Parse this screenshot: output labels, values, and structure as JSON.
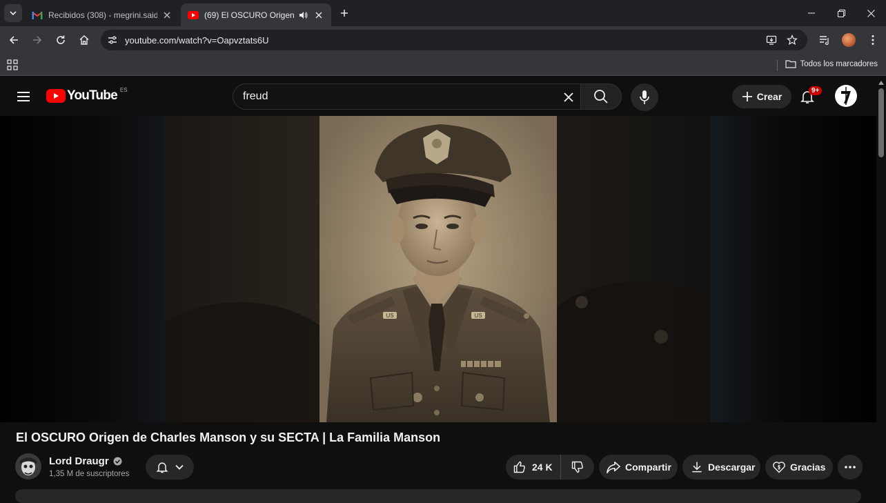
{
  "browser": {
    "tabs": [
      {
        "title": "Recibidos (308) - megrini.said@",
        "icon": "gmail-icon",
        "active": false
      },
      {
        "title": "(69) El OSCURO Origen de",
        "icon": "youtube-icon",
        "active": true,
        "audio": true
      }
    ],
    "url": "youtube.com/watch?v=Oapvztats6U",
    "bookmarks_all_label": "Todos los marcadores"
  },
  "youtube": {
    "logo_text": "YouTube",
    "country_code": "ES",
    "search_query": "freud",
    "create_label": "Crear",
    "notifications_badge": "9+"
  },
  "video": {
    "title": "El OSCURO Origen de Charles Manson y su SECTA | La Familia Manson",
    "channel_name": "Lord Draugr",
    "subscribers": "1,35 M de suscriptores",
    "likes": "24 K",
    "share_label": "Compartir",
    "download_label": "Descargar",
    "thanks_label": "Gracias",
    "portrait_badges": [
      "US",
      "US"
    ]
  },
  "colors": {
    "brand_red": "#ff0000",
    "chrome_dark": "#202124",
    "chrome_toolbar": "#35363a",
    "yt_bg": "#0f0f0f",
    "pill_bg": "#272727"
  }
}
